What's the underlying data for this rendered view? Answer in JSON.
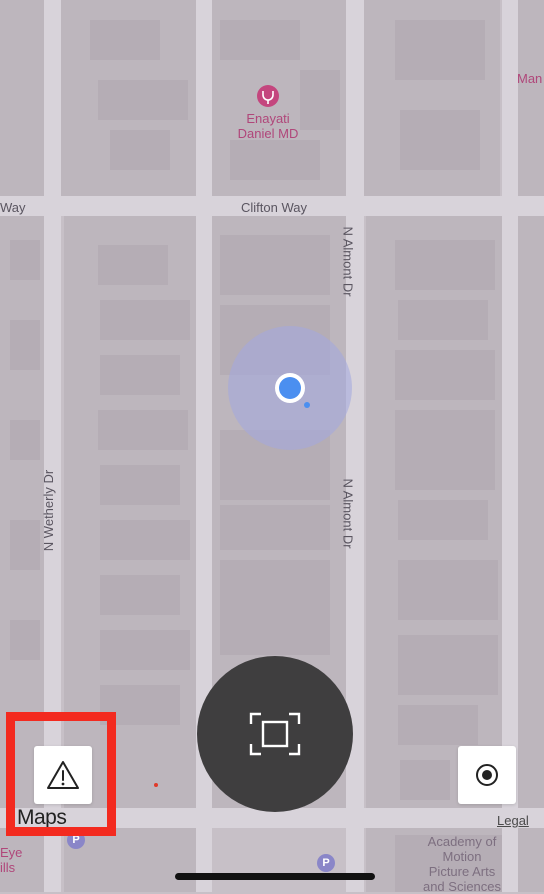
{
  "map": {
    "streets": {
      "clifton": "Clifton Way",
      "clifton_left": "Way",
      "almont_upper": "N Almont Dr",
      "almont_lower": "N Almont Dr",
      "wetherly": "N Wetherly Dr"
    },
    "poi": {
      "name_line1": "Enayati",
      "name_line2": "Daniel MD",
      "edge_label": "Man"
    },
    "bottom": {
      "academy_line1": "Academy of",
      "academy_line2": "Motion",
      "academy_line3": "Picture Arts",
      "academy_line4": "and Sciences",
      "left_line1": "Eye",
      "left_line2": "ills",
      "parking_symbol": "P"
    },
    "colors": {
      "background": "#c7c0c7",
      "block": "#bfb8bf",
      "road": "#d6d1d8",
      "location_dot": "#4b8ff0",
      "highlight": "#f32a1f"
    }
  },
  "controls": {
    "report_icon": "warning-triangle-icon",
    "locate_icon": "locate-me-icon",
    "scan_icon": "scan-frame-icon"
  },
  "footer": {
    "maps_logo": "Maps",
    "legal": "Legal"
  }
}
